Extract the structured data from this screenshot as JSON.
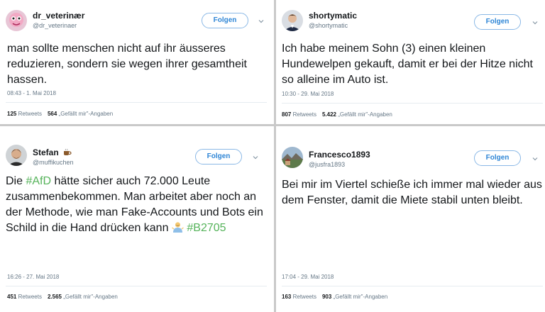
{
  "follow_label": "Folgen",
  "colors": {
    "hashtag": "#55b35a",
    "follow_border": "#8ab8e6",
    "follow_text": "#2f86d6",
    "divider": "#c9c9c9"
  },
  "tweets": [
    {
      "name": "dr_veterinær",
      "handle": "@dr_veterinaer",
      "avatar_icon": "avatar-pink-face",
      "text": "man sollte menschen nicht auf ihr äusseres reduzieren, sondern sie wegen ihrer gesamtheit hassen.",
      "time": "08:43 - 1. Mai 2018",
      "retweets_count": "125",
      "retweets_label": "Retweets",
      "likes_count": "564",
      "likes_label": "„Gefällt mir\"-Angaben"
    },
    {
      "name": "shortymatic",
      "handle": "@shortymatic",
      "avatar_icon": "avatar-man-suit",
      "text": "Ich habe meinem Sohn (3) einen kleinen Hundewelpen gekauft, damit er bei der Hitze nicht so alleine im Auto ist.",
      "time": "10:30 - 29. Mai 2018",
      "retweets_count": "807",
      "retweets_label": "Retweets",
      "likes_count": "5.422",
      "likes_label": "„Gefällt mir\"-Angaben"
    },
    {
      "name": "Stefan",
      "name_emoji": "coffee-cup-icon",
      "handle": "@muffikuchen",
      "avatar_icon": "avatar-man-beard",
      "text_before": "Die ",
      "hashtag1": "#AfD",
      "text_middle": " hätte sicher auch 72.000 Leute zusammenbekommen. Man arbeitet aber noch an der Methode, wie man Fake-Accounts und Bots ein Schild in die Hand drücken kann ",
      "emoji": "person-shrugging-icon",
      "hashtag2": "#B2705",
      "time": "16:26 - 27. Mai 2018",
      "retweets_count": "451",
      "retweets_label": "Retweets",
      "likes_count": "2.565",
      "likes_label": "„Gefällt mir\"-Angaben"
    },
    {
      "name": "Francesco1893",
      "handle": "@jusfra1893",
      "avatar_icon": "avatar-landscape",
      "text": "Bei mir im Viertel schieße ich immer mal wieder aus dem Fenster, damit die Miete stabil unten bleibt.",
      "time": "17:04 - 29. Mai 2018",
      "retweets_count": "163",
      "retweets_label": "Retweets",
      "likes_count": "903",
      "likes_label": "„Gefällt mir\"-Angaben"
    }
  ]
}
